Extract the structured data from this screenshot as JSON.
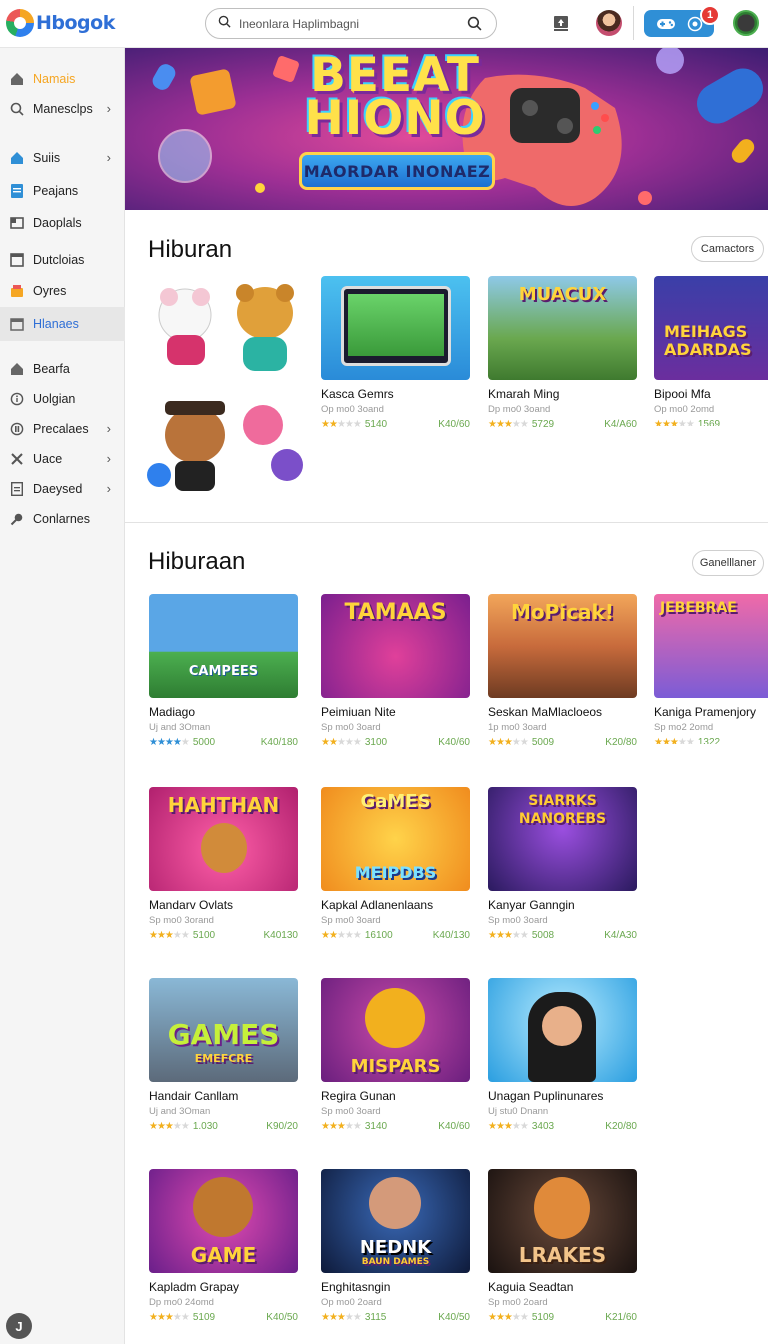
{
  "header": {
    "logo_text": "Hbogok",
    "search_placeholder": "Ineonlara Haplimbagni",
    "notification_count": "1"
  },
  "sidebar": {
    "items": [
      {
        "label": "Namais",
        "icon": "home-icon",
        "chevron": false,
        "active": false,
        "accent": true
      },
      {
        "label": "Manesclps",
        "icon": "search-icon",
        "chevron": true,
        "active": false
      },
      {
        "label": "Suiis",
        "icon": "home-icon",
        "chevron": true,
        "active": false
      },
      {
        "label": "Peajans",
        "icon": "file-icon",
        "chevron": false,
        "active": false
      },
      {
        "label": "Daoplals",
        "icon": "box-icon",
        "chevron": false,
        "active": false
      },
      {
        "label": "Dutcloias",
        "icon": "window-icon",
        "chevron": false,
        "active": false
      },
      {
        "label": "Oyres",
        "icon": "bag-icon",
        "chevron": false,
        "active": false
      },
      {
        "label": "Hlanaes",
        "icon": "calendar-icon",
        "chevron": false,
        "active": true
      },
      {
        "label": "Bearfa",
        "icon": "home-icon",
        "chevron": false,
        "active": false
      },
      {
        "label": "Uolgian",
        "icon": "info-icon",
        "chevron": false,
        "active": false
      },
      {
        "label": "Precalaes",
        "icon": "shield-icon",
        "chevron": true,
        "active": false
      },
      {
        "label": "Uace",
        "icon": "tools-icon",
        "chevron": true,
        "active": false
      },
      {
        "label": "Daeysed",
        "icon": "file-icon",
        "chevron": true,
        "active": false
      },
      {
        "label": "Conlarnes",
        "icon": "key-icon",
        "chevron": false,
        "active": false
      }
    ],
    "help_label": "J"
  },
  "banner": {
    "title": "BEEAT HIONO",
    "subtitle": "MAORDAR INONAEZ"
  },
  "sections": [
    {
      "title": "Hiburan",
      "action_label": "Camactors",
      "cards": [
        {
          "title": "Kasca Gemrs",
          "sub": "Op mo0 3oand",
          "stars": 2,
          "count": "5140",
          "right": "K40/60"
        },
        {
          "title": "Kmarah Ming",
          "sub": "Dp mo0 3oand",
          "stars": 3,
          "count": "5729",
          "right": "K4/A60"
        },
        {
          "title": "Bipooi Mfa",
          "sub": "Op mo0 2omd",
          "stars": 3,
          "count": "1569",
          "right": ""
        }
      ]
    },
    {
      "title": "Hiburaan",
      "action_label": "Ganelllaner",
      "cards": [
        {
          "title": "Madiago",
          "sub": "Uj and 3Oman",
          "stars": 4,
          "count": "5000",
          "right": "K40/180"
        },
        {
          "title": "Peimiuan Nite",
          "sub": "Sp mo0 3oard",
          "stars": 2,
          "count": "3100",
          "right": "K40/60"
        },
        {
          "title": "Seskan MaMlacloeos",
          "sub": "1p mo0 3oard",
          "stars": 3,
          "count": "5009",
          "right": "K20/80"
        },
        {
          "title": "Kaniga Pramenjory",
          "sub": "Sp mo2 2omd",
          "stars": 3,
          "count": "1322",
          "right": ""
        },
        {
          "title": "Mandarv Ovlats",
          "sub": "Sp mo0 3orand",
          "stars": 3,
          "count": "5100",
          "right": "K40130"
        },
        {
          "title": "Kapkal Adlanenlaans",
          "sub": "Sp mo0 3oard",
          "stars": 2,
          "count": "16100",
          "right": "K40/130"
        },
        {
          "title": "Kanyar Ganngin",
          "sub": "Sp mo0 3oard",
          "stars": 3,
          "count": "5008",
          "right": "K4/A30"
        },
        {
          "title": "Handair Canllam",
          "sub": "Uj and 3Oman",
          "stars": 3,
          "count": "1.030",
          "right": "K90/20"
        },
        {
          "title": "Regira Gunan",
          "sub": "Sp mo0 3oard",
          "stars": 3,
          "count": "3140",
          "right": "K40/60"
        },
        {
          "title": "Unagan Puplinunares",
          "sub": "Uj stu0 Dnann",
          "stars": 3,
          "count": "3403",
          "right": "K20/80"
        },
        {
          "title": "Kapladm Grapay",
          "sub": "Dp mo0 24omd",
          "stars": 3,
          "count": "5109",
          "right": "K40/50"
        },
        {
          "title": "Enghitasngin",
          "sub": "Op mo0 2oard",
          "stars": 3,
          "count": "3115",
          "right": "K40/50"
        },
        {
          "title": "Kaguia Seadtan",
          "sub": "Sp mo0 2oard",
          "stars": 3,
          "count": "5109",
          "right": "K21/60"
        }
      ]
    }
  ],
  "thumbnail_texts": {
    "s2c1": "CAMPEES",
    "s2c2": "TAMAAS",
    "s2c3": "MoPicak!",
    "s2c4": "JEBEBRAE",
    "s2c5": "HAHTHAN",
    "s2c6": "GaMES",
    "s2c6b": "MEIPDBS",
    "s2c7": "SIARRKS",
    "s2c7b": "NANOREBS",
    "s2c8": "GAMES",
    "s2c8b": "EMEFCRE",
    "s2c9": "MISPARS",
    "s2c11": "GAME",
    "s2c12": "NEDNK",
    "s2c12b": "BAUN DAMES",
    "s2c13": "LRAKES",
    "s1c2": "MUACUX",
    "s1c3": "MEIHAGS",
    "s1c3b": "ADARDAS"
  },
  "colors": {
    "accent": "#f5a623",
    "brand": "#2f6fd6",
    "star": "#f2b01e",
    "meta": "#6aa84f"
  }
}
